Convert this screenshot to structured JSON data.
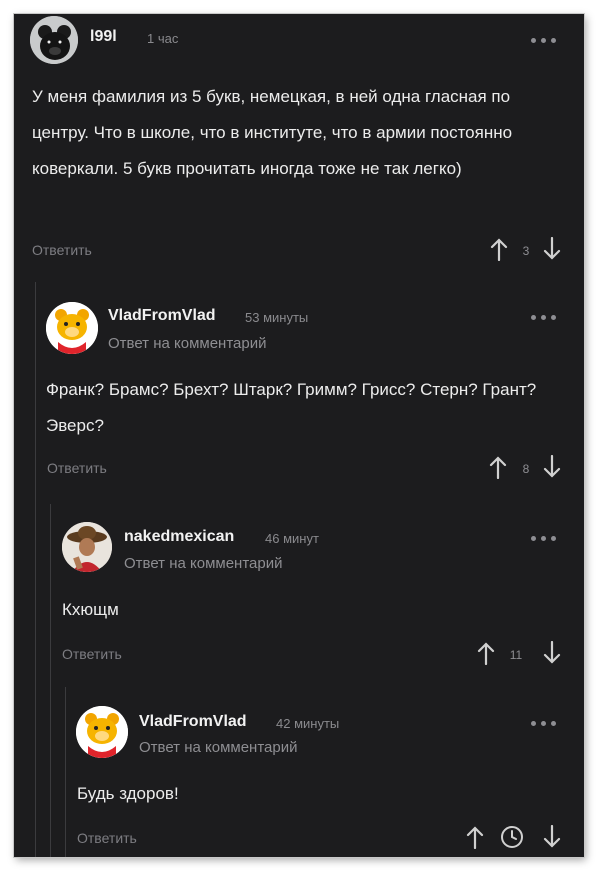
{
  "comments": [
    {
      "username": "l99l",
      "time": "1 час",
      "subtitle": "",
      "text": "У меня фамилия из 5 букв, немецкая, в ней одна гласная по центру. Что в школе, что в институте, что в армии постоянно коверкали. 5 букв прочитать иногда тоже не так легко)",
      "reply": "Ответить",
      "score": "3",
      "avatar_icon": "bear-avatar-icon"
    },
    {
      "username": "VladFromVlad",
      "time": "53 минуты",
      "subtitle": "Ответ на комментарий",
      "text": "Франк? Брамс? Брехт? Штарк? Гримм? Грисс? Стерн? Грант? Эверс?",
      "reply": "Ответить",
      "score": "8",
      "avatar_icon": "cartoon-bear-avatar-icon"
    },
    {
      "username": "nakedmexican",
      "time": "46 минут",
      "subtitle": "Ответ на комментарий",
      "text": "Кхющм",
      "reply": "Ответить",
      "score": "11",
      "avatar_icon": "sombrero-person-avatar-icon"
    },
    {
      "username": "VladFromVlad",
      "time": "42 минуты",
      "subtitle": "Ответ на комментарий",
      "text": "Будь здоров!",
      "reply": "Ответить",
      "score": "",
      "avatar_icon": "cartoon-bear-avatar-icon",
      "score_pending_icon": "clock-icon"
    }
  ],
  "colors": {
    "background": "#1c1c1e",
    "text": "#ececec",
    "muted": "#8e8e93",
    "thread_line": "#3b3b3e"
  }
}
